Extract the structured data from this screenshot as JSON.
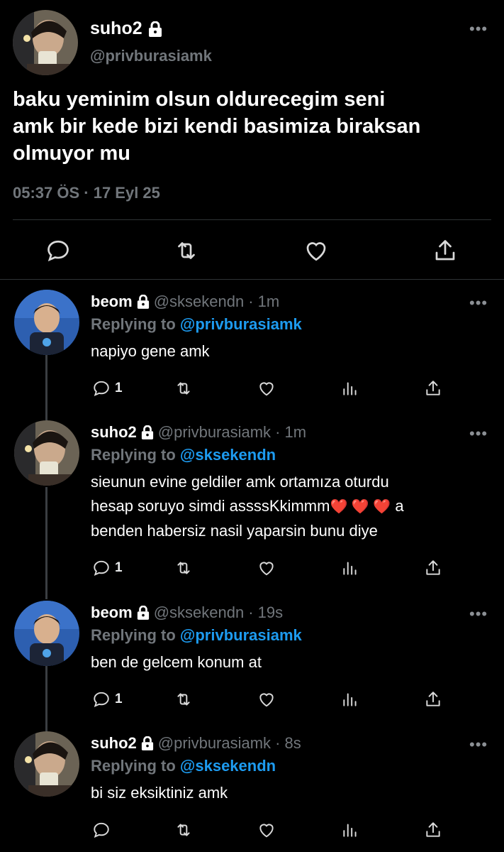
{
  "main_tweet": {
    "name": "suho2",
    "handle": "@privburasiamk",
    "text_lines": [
      "baku yeminim olsun oldurecegim seni",
      "amk bir kede bizi kendi basimiza biraksan",
      "olmuyor mu"
    ],
    "timestamp": "05:37 ÖS · 17 Eyl 25",
    "actions": [
      "reply-icon",
      "retweet-icon",
      "like-icon",
      "share-icon"
    ]
  },
  "replies": [
    {
      "name": "beom",
      "handle": "@sksekendn",
      "time": "· 1m",
      "replying_label": "Replying to",
      "replying_to": "@privburasiamk",
      "text_lines": [
        "napiyo gene amk"
      ],
      "reply_count": "1"
    },
    {
      "name": "suho2",
      "handle": "@privburasiamk",
      "time": "· 1m",
      "replying_label": "Replying to",
      "replying_to": "@sksekendn",
      "text_lines": [
        "sieunun evine geldiler amk ortamıza oturdu",
        "hesap soruyo simdi assssKkimmm",
        "benden habersiz nasil yaparsin bunu diye"
      ],
      "text_line2_suffix": "a",
      "reply_count": "1"
    },
    {
      "name": "beom",
      "handle": "@sksekendn",
      "time": "· 19s",
      "replying_label": "Replying to",
      "replying_to": "@privburasiamk",
      "text_lines": [
        "ben de gelcem konum at"
      ],
      "reply_count": "1"
    },
    {
      "name": "suho2",
      "handle": "@privburasiamk",
      "time": "· 8s",
      "replying_label": "Replying to",
      "replying_to": "@sksekendn",
      "text_lines": [
        "bi siz eksiktiniz amk"
      ],
      "reply_count": ""
    }
  ],
  "colors": {
    "background": "#000000",
    "text": "#e7e9ea",
    "muted": "#71767b",
    "link": "#1d9bf0",
    "divider": "#2f3336"
  }
}
